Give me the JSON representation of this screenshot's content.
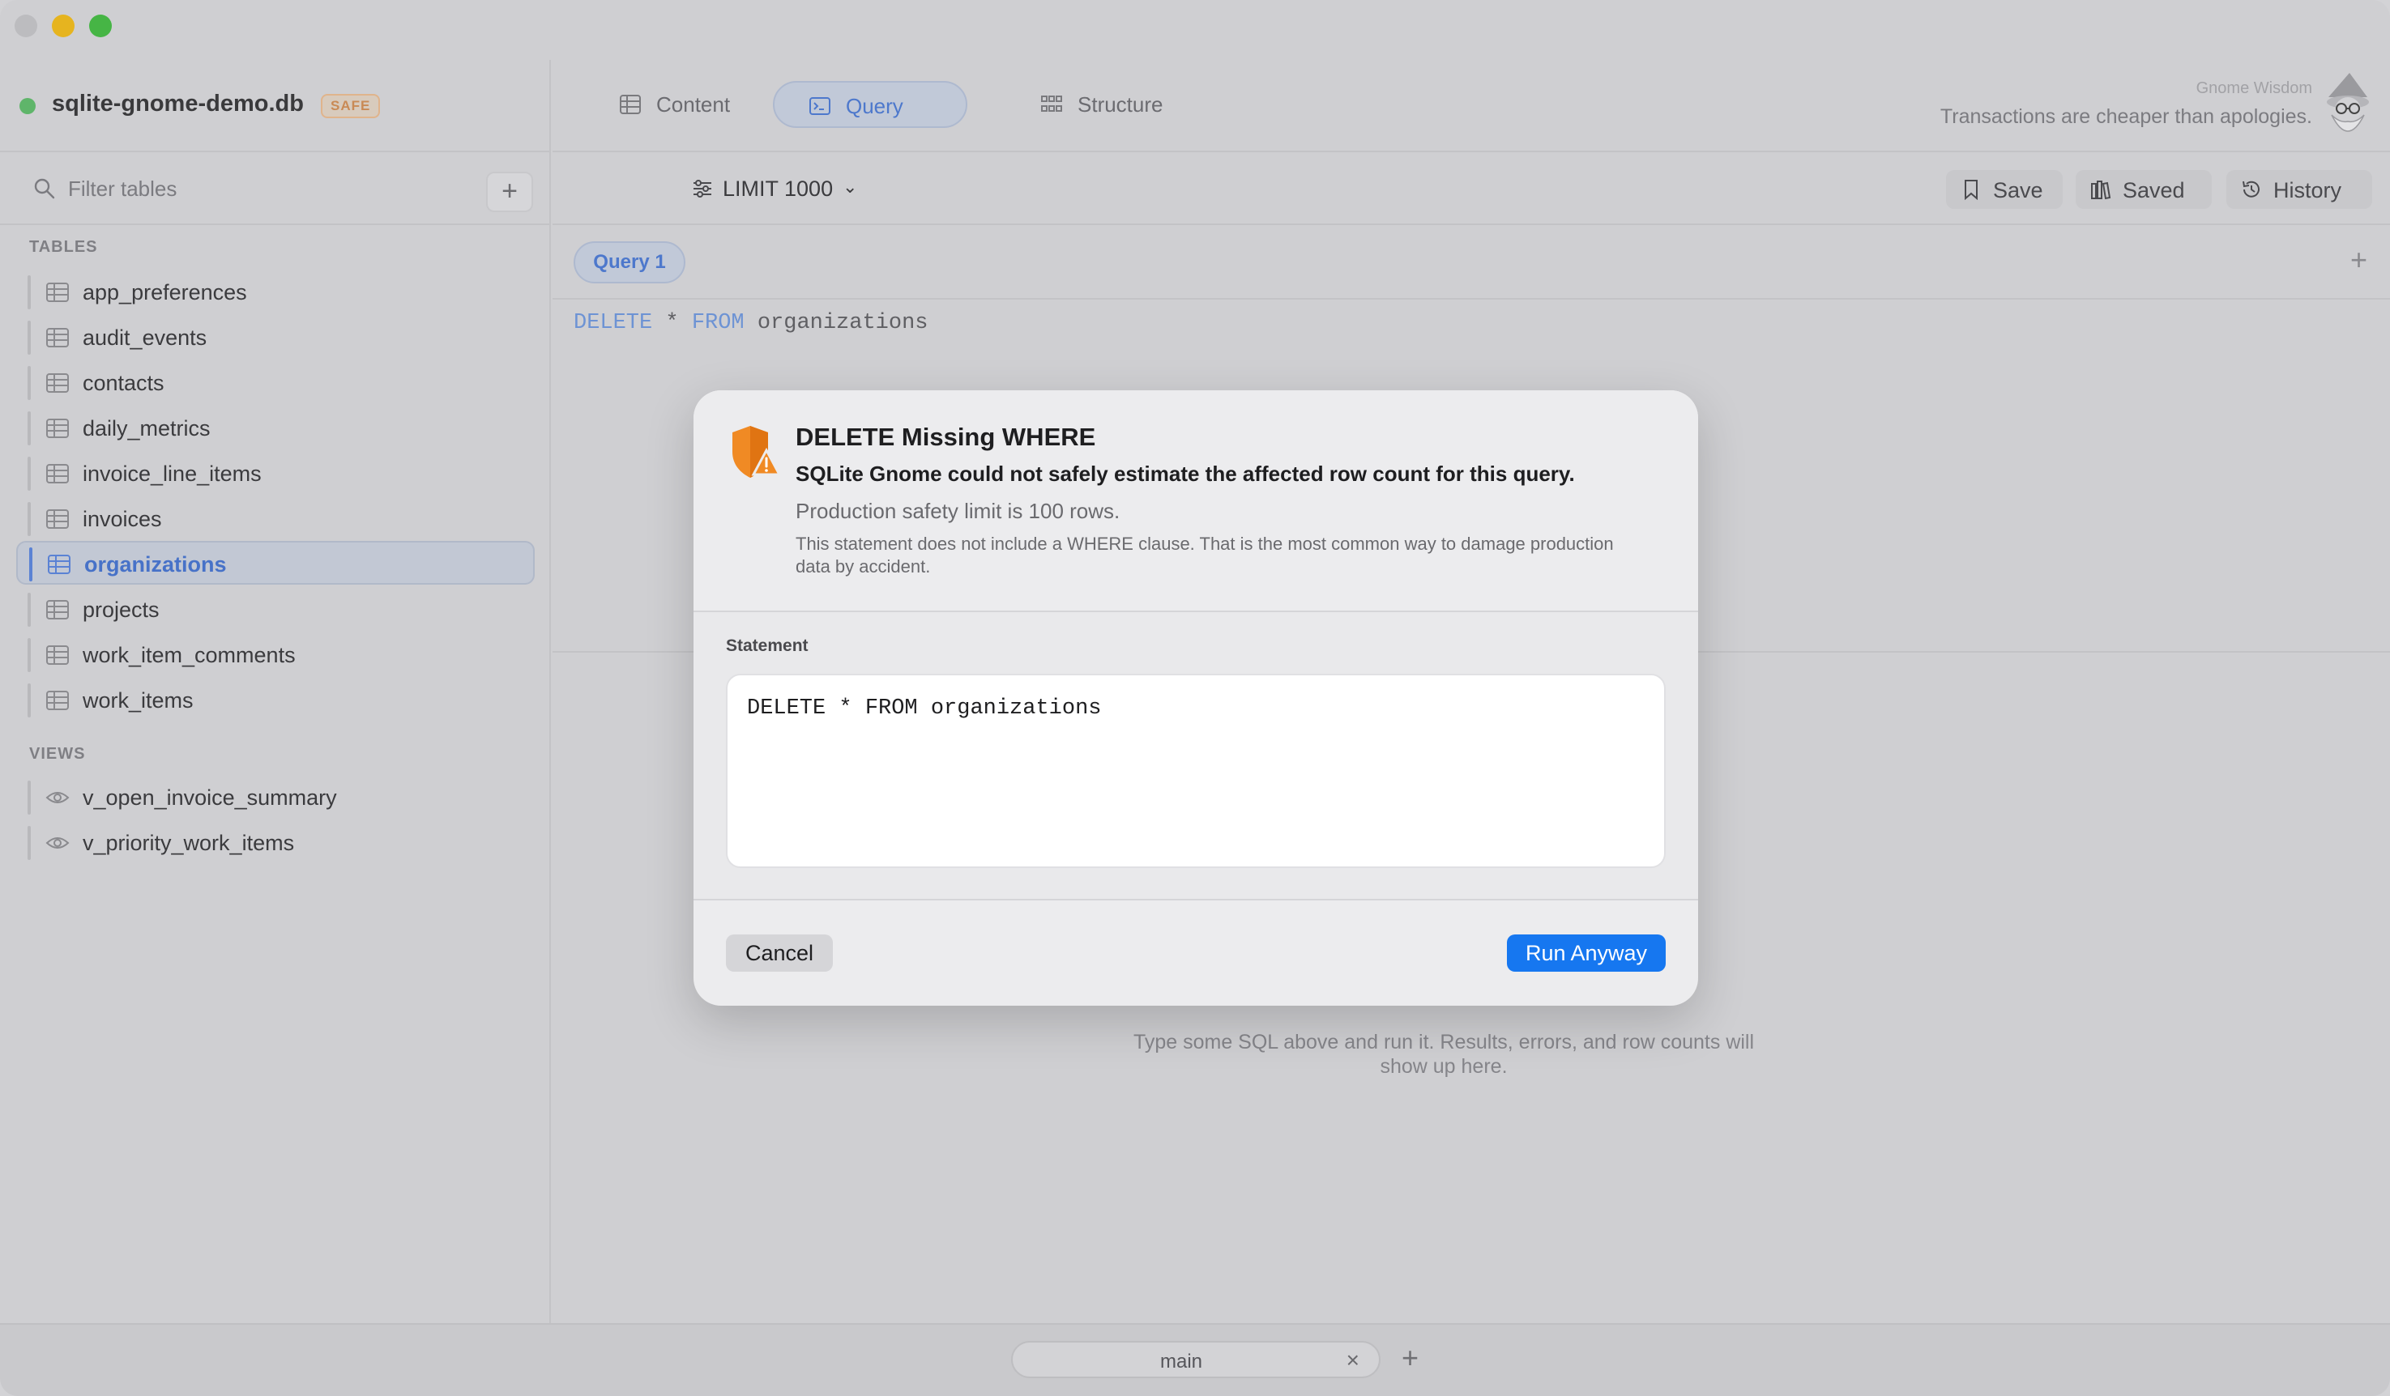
{
  "window": {
    "traffic_lights": [
      "close",
      "minimize",
      "maximize"
    ]
  },
  "sidebar": {
    "db_name": "sqlite-gnome-demo.db",
    "db_badge": "SAFE",
    "filter_placeholder": "Filter tables",
    "add_label": "+",
    "tables_heading": "TABLES",
    "tables": [
      {
        "label": "app_preferences",
        "icon": "table-icon"
      },
      {
        "label": "audit_events",
        "icon": "table-icon"
      },
      {
        "label": "contacts",
        "icon": "table-icon"
      },
      {
        "label": "daily_metrics",
        "icon": "table-icon"
      },
      {
        "label": "invoice_line_items",
        "icon": "table-icon"
      },
      {
        "label": "invoices",
        "icon": "table-icon"
      },
      {
        "label": "organizations",
        "icon": "table-icon",
        "selected": true
      },
      {
        "label": "projects",
        "icon": "table-icon"
      },
      {
        "label": "work_item_comments",
        "icon": "table-icon"
      },
      {
        "label": "work_items",
        "icon": "table-icon"
      }
    ],
    "views_heading": "VIEWS",
    "views": [
      {
        "label": "v_open_invoice_summary",
        "icon": "eye-icon"
      },
      {
        "label": "v_priority_work_items",
        "icon": "eye-icon"
      }
    ]
  },
  "header": {
    "tabs": [
      {
        "label": "Content",
        "icon": "table-icon"
      },
      {
        "label": "Query",
        "icon": "terminal-icon",
        "active": true
      },
      {
        "label": "Structure",
        "icon": "grid-icon"
      }
    ],
    "wisdom_title": "Gnome Wisdom",
    "wisdom_text": "Transactions are cheaper than apologies."
  },
  "toolbar": {
    "limit_label": "LIMIT 1000",
    "save_label": "Save",
    "saved_label": "Saved",
    "history_label": "History"
  },
  "query_tabs": {
    "tabs": [
      {
        "label": "Query 1",
        "active": true
      }
    ],
    "add_label": "+"
  },
  "editor": {
    "keyword_delete": "DELETE",
    "operator": "*",
    "keyword_from": "FROM",
    "table": "organizations"
  },
  "results": {
    "empty_hint": "Type some SQL above and run it. Results, errors, and row counts will show up here."
  },
  "bottom": {
    "db_tab_label": "main",
    "close_glyph": "×",
    "add_label": "+"
  },
  "modal": {
    "title": "DELETE Missing WHERE",
    "subtitle": "SQLite Gnome could not safely estimate the affected row count for this query.",
    "limit_text": "Production safety limit is 100 rows.",
    "description": "This statement does not include a WHERE clause. That is the most common way to damage production data by accident.",
    "statement_label": "Statement",
    "statement": "DELETE * FROM organizations",
    "cancel_label": "Cancel",
    "run_label": "Run Anyway"
  },
  "colors": {
    "accent": "#1677f0",
    "selection": "#4772c8",
    "warning": "#f08a24",
    "status_green": "#5fb56a"
  }
}
